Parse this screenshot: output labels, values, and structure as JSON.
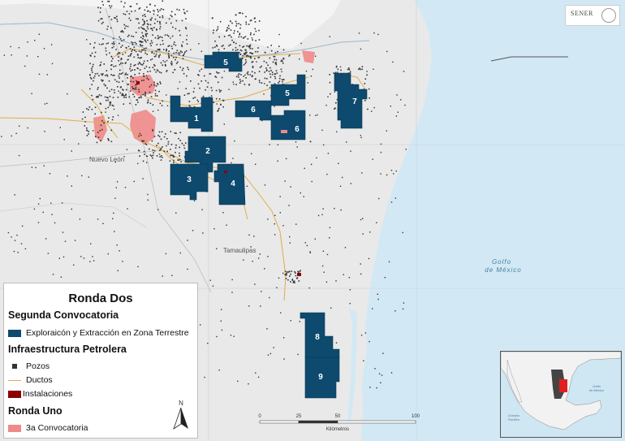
{
  "map": {
    "title": "Ronda Dos",
    "regions": {
      "nuevo_leon": "Nuevo León",
      "tamaulipas": "Tamaulipas",
      "gulf_line1": "Golfo",
      "gulf_line2": "de México"
    },
    "blocks": [
      {
        "id": "1",
        "label": "1"
      },
      {
        "id": "2",
        "label": "2"
      },
      {
        "id": "3",
        "label": "3"
      },
      {
        "id": "4",
        "label": "4"
      },
      {
        "id": "5a",
        "label": "5"
      },
      {
        "id": "5b",
        "label": "5"
      },
      {
        "id": "6a",
        "label": "6"
      },
      {
        "id": "6b",
        "label": "6"
      },
      {
        "id": "7",
        "label": "7"
      },
      {
        "id": "8",
        "label": "8"
      },
      {
        "id": "9",
        "label": "9"
      }
    ],
    "scale_bar": {
      "ticks": [
        "0",
        "25",
        "50",
        "100"
      ],
      "unit": "Kilómetros"
    },
    "north_label": "N",
    "logo_text": "SENER",
    "inset": {
      "gulf_label_line1": "Golfo",
      "gulf_label_line2": "de México",
      "ocean_label_line1": "Océano",
      "ocean_label_line2": "Pacífico"
    },
    "colors": {
      "block": "#0d4a6e",
      "ronda_uno": "#f08a8a",
      "wells": "#333333",
      "pipelines": "#e0ad4a",
      "installations": "#8b0000",
      "sea": "#d2e9f5",
      "land": "#e9e9e9"
    }
  },
  "legend": {
    "title": "Ronda Dos",
    "sections": [
      {
        "header": "Segunda Convocatoria",
        "items": [
          {
            "label": "Exploraicón y Extracción en Zona Terrestre",
            "symbol": "block"
          }
        ]
      },
      {
        "header": "Infraestructura Petrolera",
        "items": [
          {
            "label": "Pozos",
            "symbol": "wells"
          },
          {
            "label": "Ductos",
            "symbol": "pipelines"
          },
          {
            "label": "Instalaciones",
            "symbol": "installations"
          }
        ]
      },
      {
        "header": "Ronda Uno",
        "items": [
          {
            "label": "3a Convocatoria",
            "symbol": "ronda_uno"
          }
        ]
      }
    ]
  }
}
